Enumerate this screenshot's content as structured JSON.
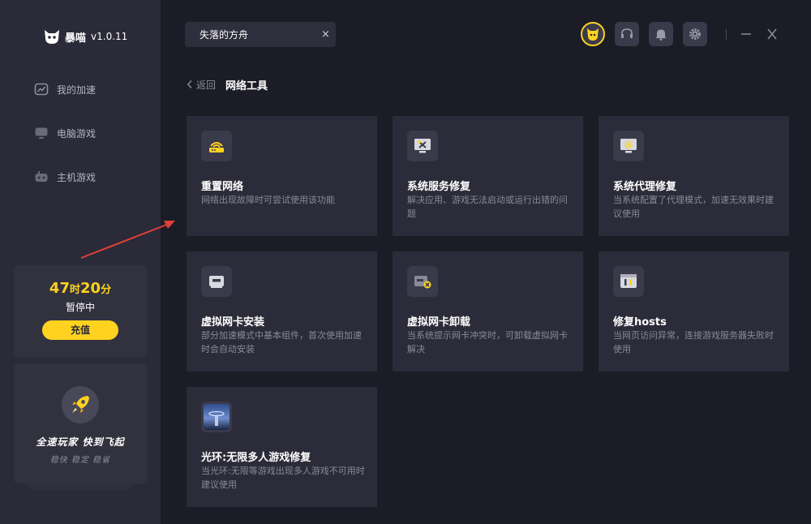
{
  "app": {
    "name": "暴喵",
    "version": "v1.0.11"
  },
  "sidebar": {
    "items": [
      {
        "label": "我的加速",
        "icon": "chart-icon"
      },
      {
        "label": "电脑游戏",
        "icon": "monitor-icon"
      },
      {
        "label": "主机游戏",
        "icon": "console-icon"
      }
    ],
    "time": {
      "hours": "47",
      "hours_unit": "时",
      "minutes": "20",
      "minutes_unit": "分",
      "status": "暂停中",
      "recharge_label": "充值"
    },
    "promo": {
      "title": "全速玩家  快到飞起",
      "subtitle": "稳快  稳定  稳省"
    }
  },
  "search": {
    "value": "失落的方舟",
    "placeholder": "",
    "clear": "×"
  },
  "breadcrumb": {
    "back": "返回",
    "title": "网络工具"
  },
  "tools": [
    {
      "title": "重置网络",
      "desc": "网络出现故障时可尝试使用该功能",
      "icon": "router-icon"
    },
    {
      "title": "系统服务修复",
      "desc": "解决应用、游戏无法启动或运行出错的问题",
      "icon": "monitor-tools-icon"
    },
    {
      "title": "系统代理修复",
      "desc": "当系统配置了代理模式，加速无效果时建议使用",
      "icon": "monitor-gear-icon"
    },
    {
      "title": "虚拟网卡安装",
      "desc": "部分加速模式中基本组件，首次使用加速时会自动安装",
      "icon": "network-card-icon"
    },
    {
      "title": "虚拟网卡卸载",
      "desc": "当系统提示网卡冲突时，可卸载虚拟网卡解决",
      "icon": "network-card-remove-icon"
    },
    {
      "title": "修复hosts",
      "desc": "当网页访问异常，连接游戏服务器失败时使用",
      "icon": "hosts-tools-icon"
    },
    {
      "title": "光环:无限多人游戏修复",
      "desc": "当光环:无限等游戏出现多人游戏不可用时建议使用",
      "icon": "halo-game-icon"
    }
  ],
  "colors": {
    "accent": "#ffd21f",
    "background": "#1c1c26",
    "sidebar": "#2a2a38",
    "card": "#2b2b39",
    "arrow": "#e0403a"
  }
}
